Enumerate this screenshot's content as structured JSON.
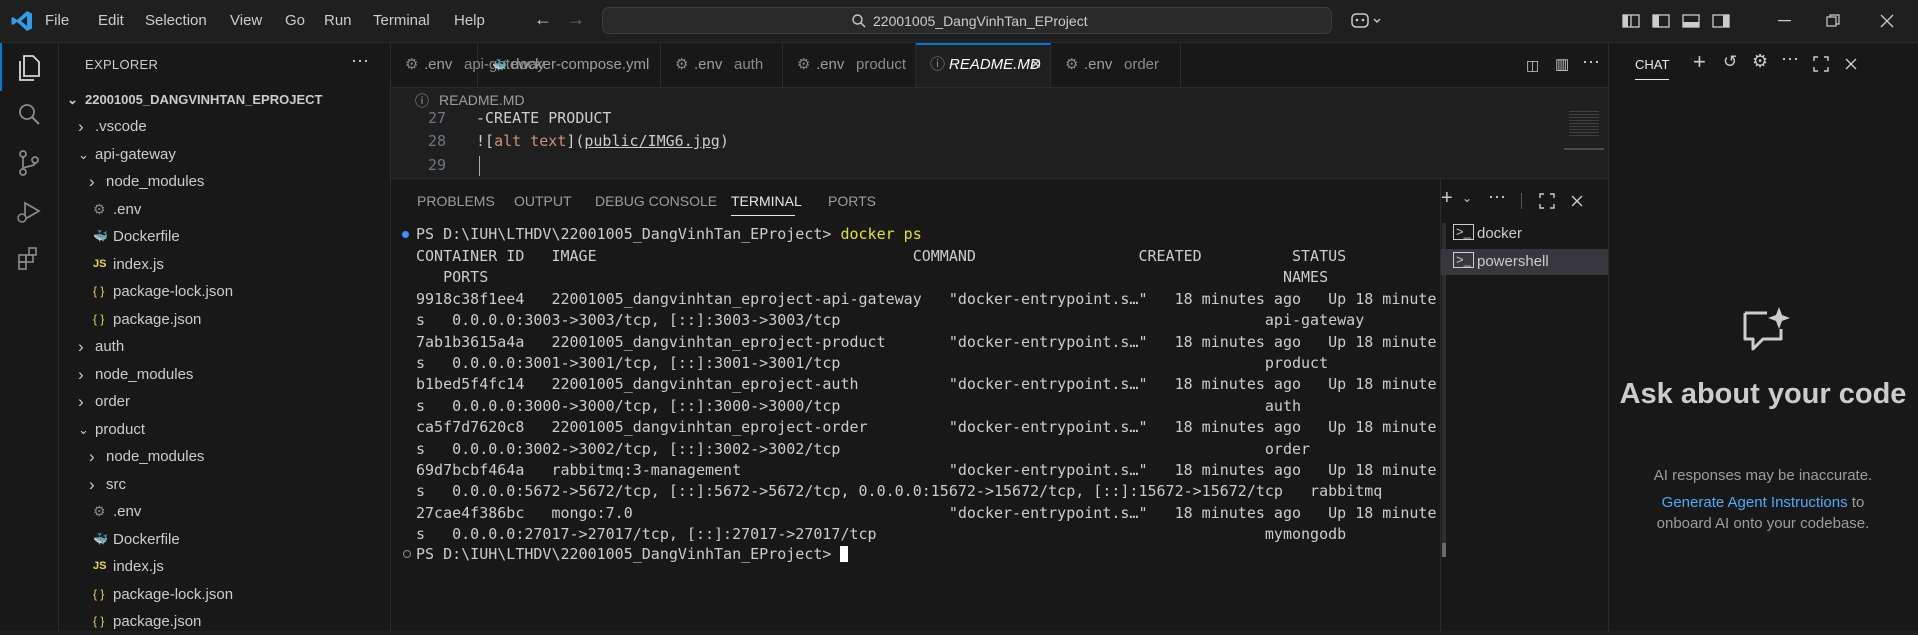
{
  "menu": [
    "File",
    "Edit",
    "Selection",
    "View",
    "Go",
    "Run",
    "Terminal",
    "Help"
  ],
  "search": {
    "text": "22001005_DangVinhTan_EProject"
  },
  "explorer": {
    "title": "EXPLORER",
    "root": "22001005_DANGVINHTAN_EPROJECT",
    "items": [
      {
        "label": ".vscode",
        "kind": "folder",
        "open": false
      },
      {
        "label": "api-gateway",
        "kind": "folder",
        "open": true
      },
      {
        "label": "node_modules",
        "kind": "folder",
        "open": false
      },
      {
        "label": ".env",
        "kind": "gear"
      },
      {
        "label": "Dockerfile",
        "kind": "docker"
      },
      {
        "label": "index.js",
        "kind": "js",
        "icon_text": "JS"
      },
      {
        "label": "package-lock.json",
        "kind": "json",
        "icon_text": "{ }"
      },
      {
        "label": "package.json",
        "kind": "json",
        "icon_text": "{ }"
      },
      {
        "label": "auth",
        "kind": "folder",
        "open": false
      },
      {
        "label": "node_modules",
        "kind": "folder",
        "open": false
      },
      {
        "label": "order",
        "kind": "folder",
        "open": false
      },
      {
        "label": "product",
        "kind": "folder",
        "open": true
      },
      {
        "label": "node_modules",
        "kind": "folder",
        "open": false
      },
      {
        "label": "src",
        "kind": "folder",
        "open": false
      },
      {
        "label": ".env",
        "kind": "gear"
      },
      {
        "label": "Dockerfile",
        "kind": "docker"
      },
      {
        "label": "index.js",
        "kind": "js",
        "icon_text": "JS"
      },
      {
        "label": "package-lock.json",
        "kind": "json",
        "icon_text": "{ }"
      },
      {
        "label": "package.json",
        "kind": "json",
        "icon_text": "{ }"
      }
    ]
  },
  "tabs": [
    {
      "name": ".env",
      "desc": "api-gateway",
      "icon": "gear"
    },
    {
      "name": "docker-compose.yml",
      "desc": "",
      "icon": "docker"
    },
    {
      "name": ".env",
      "desc": "auth",
      "icon": "gear"
    },
    {
      "name": ".env",
      "desc": "product",
      "icon": "gear"
    },
    {
      "name": "README.MD",
      "desc": "",
      "icon": "info",
      "active": true
    },
    {
      "name": ".env",
      "desc": "order",
      "icon": "gear"
    }
  ],
  "breadcrumb": "README.MD",
  "editor_lines": [
    {
      "num": "27",
      "text": "-CREATE PRODUCT"
    },
    {
      "num": "28",
      "alt": "alt text",
      "path": "public/IMG6.jpg"
    },
    {
      "num": "29",
      "text": ""
    }
  ],
  "panel_tabs": [
    "PROBLEMS",
    "OUTPUT",
    "DEBUG CONSOLE",
    "TERMINAL",
    "PORTS"
  ],
  "terminal": {
    "prompt": "PS D:\\IUH\\LTHDV\\22001005_DangVinhTan_EProject>",
    "command": "docker ps",
    "lines": [
      "CONTAINER ID   IMAGE                                   COMMAND                  CREATED          STATUS",
      "   PORTS                                                                                        NAMES",
      "9918c38f1ee4   22001005_dangvinhtan_eproject-api-gateway   \"docker-entrypoint.s…\"   18 minutes ago   Up 18 minute",
      "s   0.0.0.0:3003->3003/tcp, [::]:3003->3003/tcp                                               api-gateway",
      "7ab1b3615a4a   22001005_dangvinhtan_eproject-product       \"docker-entrypoint.s…\"   18 minutes ago   Up 18 minute",
      "s   0.0.0.0:3001->3001/tcp, [::]:3001->3001/tcp                                               product",
      "b1bed5f4fc14   22001005_dangvinhtan_eproject-auth          \"docker-entrypoint.s…\"   18 minutes ago   Up 18 minute",
      "s   0.0.0.0:3000->3000/tcp, [::]:3000->3000/tcp                                               auth",
      "ca5f7d7620c8   22001005_dangvinhtan_eproject-order         \"docker-entrypoint.s…\"   18 minutes ago   Up 18 minute",
      "s   0.0.0.0:3002->3002/tcp, [::]:3002->3002/tcp                                               order",
      "69d7bcbf464a   rabbitmq:3-management                       \"docker-entrypoint.s…\"   18 minutes ago   Up 18 minute",
      "s   0.0.0.0:5672->5672/tcp, [::]:5672->5672/tcp, 0.0.0.0:15672->15672/tcp, [::]:15672->15672/tcp   rabbitmq",
      "27cae4f386bc   mongo:7.0                                   \"docker-entrypoint.s…\"   18 minutes ago   Up 18 minute",
      "s   0.0.0.0:27017->27017/tcp, [::]:27017->27017/tcp                                           mymongodb"
    ],
    "final_prompt": "PS D:\\IUH\\LTHDV\\22001005_DangVinhTan_EProject>"
  },
  "terminal_list": [
    "docker",
    "powershell"
  ],
  "chat": {
    "title": "CHAT",
    "heading": "Ask about your code",
    "note": "AI responses may be inaccurate.",
    "link": "Generate Agent Instructions",
    "link_suffix": " to",
    "line2": "onboard AI onto your codebase."
  },
  "colors": {
    "accent": "#0078d4",
    "link": "#4daafc",
    "bg": "#1f1f1f",
    "sidebar": "#181818"
  }
}
